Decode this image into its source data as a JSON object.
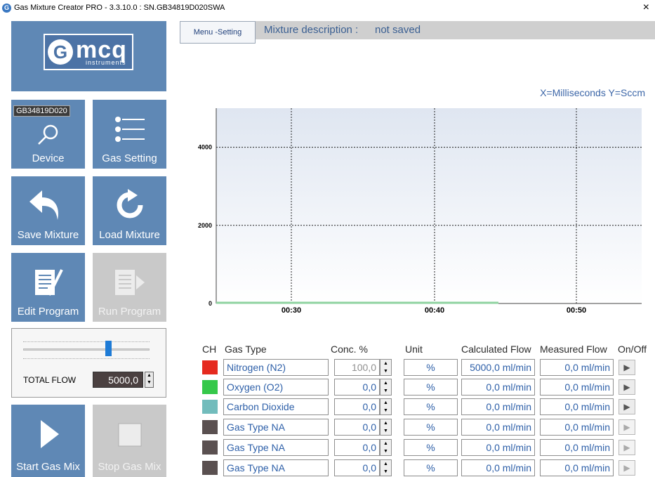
{
  "window": {
    "title": "Gas Mixture Creator PRO - 3.3.10.0 : SN.GB34819D020SWA",
    "close": "×"
  },
  "logo": {
    "text": "mcq",
    "sub": "instruments",
    "g": "G"
  },
  "tiles": {
    "device": {
      "label": "Device",
      "serial": "GB34819D020"
    },
    "gas_setting": {
      "label": "Gas Setting"
    },
    "save_mixture": {
      "label": "Save Mixture"
    },
    "load_mixture": {
      "label": "Load Mixture"
    },
    "edit_program": {
      "label": "Edit Program"
    },
    "run_program": {
      "label": "Run Program"
    },
    "start_gas_mix": {
      "label": "Start Gas Mix"
    },
    "stop_gas_mix": {
      "label": "Stop Gas Mix"
    }
  },
  "flow": {
    "label": "TOTAL FLOW",
    "value": "5000,0",
    "slider_fraction": 0.67
  },
  "menu_setting": "Menu -Setting",
  "description": {
    "label": "Mixture description :",
    "value": "not saved"
  },
  "axis_caption": "X=Milliseconds Y=Sccm",
  "chart_data": {
    "type": "line",
    "y_ticks": [
      "0",
      "2000",
      "4000"
    ],
    "x_ticks": [
      "00:30",
      "00:40",
      "00:50"
    ],
    "ylim": [
      0,
      5000
    ],
    "grid": true,
    "series": [
      {
        "color": "#8fd3a0",
        "x": [
          0,
          20
        ],
        "y": [
          0,
          0
        ]
      }
    ]
  },
  "table": {
    "headers": {
      "ch": "CH",
      "gas": "Gas Type",
      "conc": "Conc. %",
      "unit": "Unit",
      "calc": "Calculated Flow",
      "meas": "Measured Flow",
      "onoff": "On/Off"
    },
    "rows": [
      {
        "color": "#e52a1f",
        "gas": "Nitrogen (N2)",
        "conc": "100,0",
        "unit": "%",
        "calc": "5000,0 ml/min",
        "meas": "0,0 ml/min",
        "on": "▶"
      },
      {
        "color": "#35c84a",
        "gas": "Oxygen (O2)",
        "conc": "0,0",
        "unit": "%",
        "calc": "0,0 ml/min",
        "meas": "0,0 ml/min",
        "on": "▶"
      },
      {
        "color": "#72bcbc",
        "gas": "Carbon Dioxide",
        "conc": "0,0",
        "unit": "%",
        "calc": "0,0 ml/min",
        "meas": "0,0 ml/min",
        "on": "▶"
      },
      {
        "color": "#5a5050",
        "gas": "Gas Type NA",
        "conc": "0,0",
        "unit": "%",
        "calc": "0,0 ml/min",
        "meas": "0,0 ml/min",
        "on": "▶"
      },
      {
        "color": "#5a5050",
        "gas": "Gas Type NA",
        "conc": "0,0",
        "unit": "%",
        "calc": "0,0 ml/min",
        "meas": "0,0 ml/min",
        "on": "▶"
      },
      {
        "color": "#5a5050",
        "gas": "Gas Type NA",
        "conc": "0,0",
        "unit": "%",
        "calc": "0,0 ml/min",
        "meas": "0,0 ml/min",
        "on": "▶"
      }
    ]
  }
}
